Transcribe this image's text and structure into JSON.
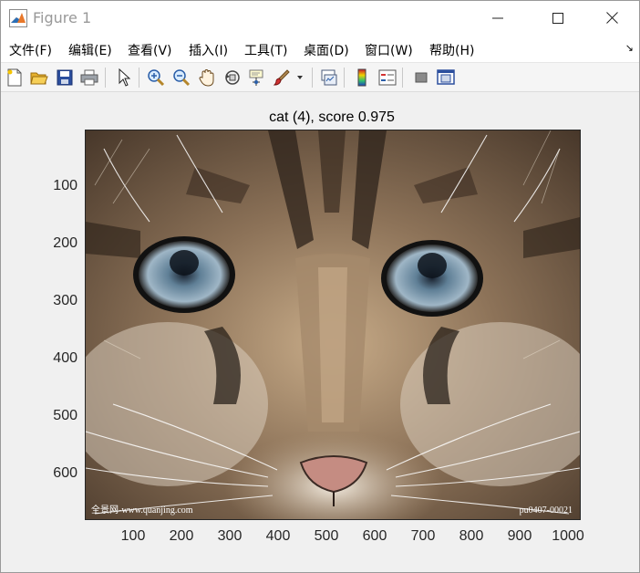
{
  "window": {
    "title": "Figure 1",
    "controls": [
      "minimize",
      "maximize",
      "close"
    ]
  },
  "menu": {
    "items": [
      {
        "label": "文件(F)"
      },
      {
        "label": "编辑(E)"
      },
      {
        "label": "查看(V)"
      },
      {
        "label": "插入(I)"
      },
      {
        "label": "工具(T)"
      },
      {
        "label": "桌面(D)"
      },
      {
        "label": "窗口(W)"
      },
      {
        "label": "帮助(H)"
      }
    ],
    "dock_arrow": "↘"
  },
  "toolbar": {
    "buttons": [
      "new-figure-icon",
      "open-file-icon",
      "save-icon",
      "print-icon",
      "pointer-icon",
      "zoom-in-icon",
      "zoom-out-icon",
      "pan-icon",
      "rotate-3d-icon",
      "data-cursor-icon",
      "brush-icon",
      "brush-dropdown-icon",
      "link-plot-icon",
      "colorbar-icon",
      "legend-icon",
      "hide-plot-tools-icon",
      "show-plot-tools-icon"
    ]
  },
  "axes": {
    "title": "cat (4), score 0.975",
    "y_ticks": [
      "100",
      "200",
      "300",
      "400",
      "500",
      "600"
    ],
    "x_ticks": [
      "100",
      "200",
      "300",
      "400",
      "500",
      "600",
      "700",
      "800",
      "900",
      "1000"
    ]
  },
  "image": {
    "watermark_left": "全景网-www.quanjing.com",
    "watermark_right": "pu0407-00021"
  }
}
